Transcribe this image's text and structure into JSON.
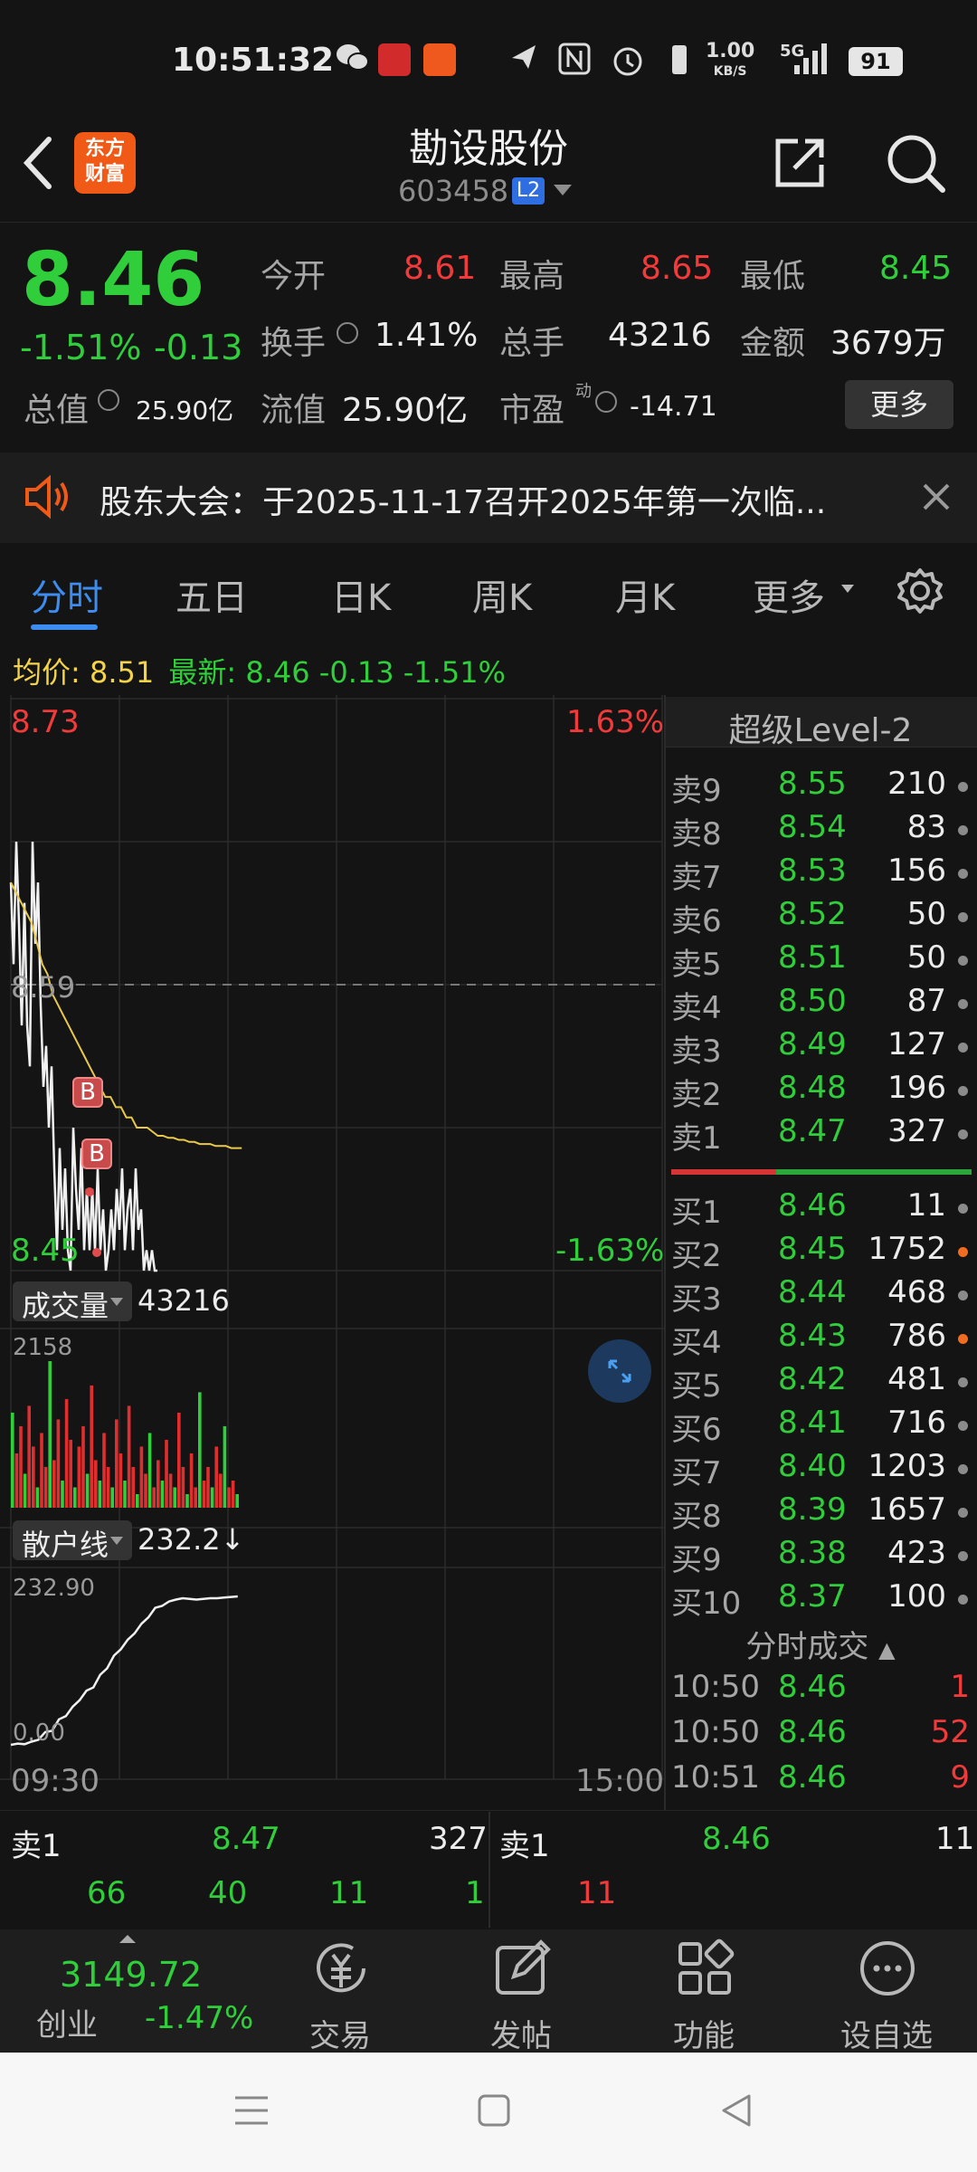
{
  "status": {
    "time": "10:51:32",
    "net_speed_top": "1.00",
    "net_speed_unit": "KB/S",
    "signal": "5G",
    "battery": "91"
  },
  "header": {
    "title": "勘设股份",
    "code": "603458",
    "level_badge": "L2",
    "logo_line1": "东方",
    "logo_line2": "财富"
  },
  "quote": {
    "price": "8.46",
    "change_pct": "-1.51%",
    "change": "-0.13",
    "open_label": "今开",
    "open": "8.61",
    "high_label": "最高",
    "high": "8.65",
    "low_label": "最低",
    "low": "8.45",
    "turnover_label": "换手",
    "turnover": "1.41%",
    "volume_label": "总手",
    "volume": "43216",
    "amount_label": "金额",
    "amount": "3679万",
    "mktcap_label": "总值",
    "mktcap": "25.90亿",
    "float_label": "流值",
    "float": "25.90亿",
    "pe_label": "市盈",
    "pe_sup": "动",
    "pe": "-14.71",
    "more": "更多"
  },
  "notice": {
    "text": "股东大会：于2025-11-17召开2025年第一次临..."
  },
  "tabs": [
    "分时",
    "五日",
    "日K",
    "周K",
    "月K",
    "更多"
  ],
  "infoline": {
    "avg_label": "均价:",
    "avg": "8.51",
    "latest_label": "最新:",
    "latest": "8.46",
    "chg": "-0.13",
    "pct": "-1.51%"
  },
  "chart_data": {
    "type": "line",
    "price_axis": {
      "top": "8.73",
      "bottom": "8.45",
      "mid": "8.59",
      "top_pct": "1.63%",
      "bottom_pct": "-1.63%"
    },
    "time_axis": {
      "start": "09:30",
      "end": "15:00"
    },
    "price_series": [
      8.64,
      8.6,
      8.66,
      8.62,
      8.57,
      8.63,
      8.57,
      8.55,
      8.66,
      8.61,
      8.64,
      8.58,
      8.54,
      8.56,
      8.52,
      8.55,
      8.5,
      8.46,
      8.51,
      8.47,
      8.5,
      8.46,
      8.45,
      8.52,
      8.49,
      8.47,
      8.51,
      8.46,
      8.49,
      8.46,
      8.49,
      8.46,
      8.5,
      8.46,
      8.48,
      8.45,
      8.46,
      8.48,
      8.46,
      8.49,
      8.47,
      8.5,
      8.46,
      8.48,
      8.49,
      8.46,
      8.5,
      8.47,
      8.48,
      8.45,
      8.46,
      8.45,
      8.46,
      8.45,
      8.45
    ],
    "avg_series": [
      8.64,
      8.635,
      8.63,
      8.625,
      8.62,
      8.61,
      8.6,
      8.595,
      8.585,
      8.58,
      8.575,
      8.57,
      8.565,
      8.56,
      8.555,
      8.55,
      8.545,
      8.54,
      8.535,
      8.535,
      8.53,
      8.53,
      8.525,
      8.525,
      8.52,
      8.52,
      8.52,
      8.518,
      8.516,
      8.516,
      8.515,
      8.515,
      8.514,
      8.514,
      8.513,
      8.513,
      8.512,
      8.512,
      8.512,
      8.511,
      8.511,
      8.511,
      8.51,
      8.51,
      8.51
    ],
    "buy_markers": [
      "B",
      "B"
    ],
    "volume_label": "成交量",
    "volume_value": "43216",
    "volume_max": "2158",
    "volume_bars": [
      1400,
      800,
      1200,
      500,
      1500,
      900,
      300,
      1100,
      600,
      2158,
      700,
      1300,
      400,
      1600,
      1000,
      300,
      900,
      1200,
      500,
      1800,
      700,
      400,
      1100,
      600,
      300,
      1300,
      800,
      400,
      1500,
      600,
      200,
      900,
      500,
      1100,
      300,
      700,
      400,
      1000,
      500,
      300,
      1400,
      600,
      200,
      800,
      300,
      1700,
      400,
      600,
      300,
      900,
      500,
      1200,
      300,
      400,
      200
    ],
    "retail_label": "散户线",
    "retail_value": "232.2↓",
    "retail_max": "232.90",
    "retail_min": "0.00",
    "retail_series": [
      0,
      2,
      1,
      5,
      8,
      20,
      22,
      40,
      45,
      60,
      70,
      85,
      90,
      110,
      120,
      140,
      150,
      165,
      175,
      190,
      200,
      215,
      218,
      225,
      228,
      230,
      229,
      228,
      229,
      230,
      230,
      231,
      232,
      232.9
    ]
  },
  "orderbook": {
    "title": "超级Level-2",
    "asks": [
      [
        "卖9",
        "8.55",
        "210"
      ],
      [
        "卖8",
        "8.54",
        "83"
      ],
      [
        "卖7",
        "8.53",
        "156"
      ],
      [
        "卖6",
        "8.52",
        "50"
      ],
      [
        "卖5",
        "8.51",
        "50"
      ],
      [
        "卖4",
        "8.50",
        "87"
      ],
      [
        "卖3",
        "8.49",
        "127"
      ],
      [
        "卖2",
        "8.48",
        "196"
      ],
      [
        "卖1",
        "8.47",
        "327"
      ]
    ],
    "bids": [
      [
        "买1",
        "8.46",
        "11"
      ],
      [
        "买2",
        "8.45",
        "1752"
      ],
      [
        "买3",
        "8.44",
        "468"
      ],
      [
        "买4",
        "8.43",
        "786"
      ],
      [
        "买5",
        "8.42",
        "481"
      ],
      [
        "买6",
        "8.41",
        "716"
      ],
      [
        "买7",
        "8.40",
        "1203"
      ],
      [
        "买8",
        "8.39",
        "1657"
      ],
      [
        "买9",
        "8.38",
        "423"
      ],
      [
        "买10",
        "8.37",
        "100"
      ]
    ],
    "ticks_title": "分时成交",
    "ticks": [
      [
        "10:50",
        "8.46",
        "1"
      ],
      [
        "10:50",
        "8.46",
        "52"
      ],
      [
        "10:51",
        "8.46",
        "9"
      ]
    ]
  },
  "bottom_ticker": {
    "sell_label": "卖1",
    "sell_price": "8.47",
    "sell_vol": "327",
    "buy_label": "卖1",
    "buy_price": "8.46",
    "buy_vol": "11",
    "q1": "66",
    "q2": "40",
    "q3": "11",
    "q4": "1",
    "q5": "11"
  },
  "bottom_nav": {
    "index_value": "3149.72",
    "index_name": "创业",
    "index_pct": "-1.47%",
    "trade": "交易",
    "post": "发帖",
    "function": "功能",
    "watchlist": "设自选"
  }
}
